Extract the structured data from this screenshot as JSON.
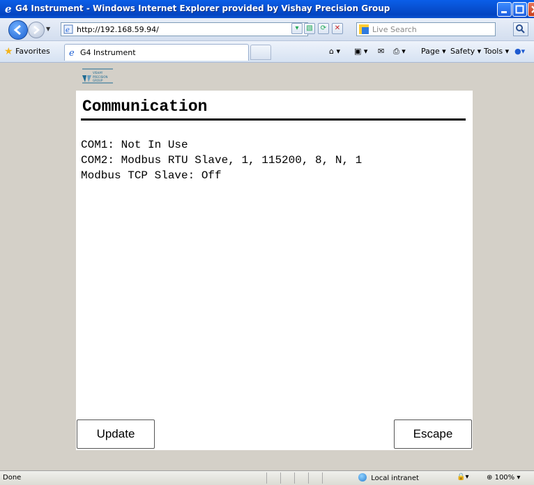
{
  "window": {
    "title": "G4 Instrument - Windows Internet Explorer provided by Vishay Precision Group"
  },
  "address_bar": {
    "url": "http://192.168.59.94/",
    "search_placeholder": "Live Search"
  },
  "favorites_bar": {
    "favorites_label": "Favorites",
    "tab_label": "G4 Instrument",
    "commands": [
      "Page ▾",
      "Safety ▾",
      "Tools ▾"
    ]
  },
  "page": {
    "heading": "Communication",
    "lines": [
      "COM1: Not In Use",
      "COM2: Modbus RTU Slave, 1, 115200, 8, N, 1",
      "Modbus TCP Slave: Off"
    ],
    "update_button": "Update",
    "escape_button": "Escape",
    "brand_logo_text": "VISHAY PRECISION GROUP"
  },
  "status_bar": {
    "status": "Done",
    "zone": "Local intranet",
    "zoom": "100%"
  }
}
